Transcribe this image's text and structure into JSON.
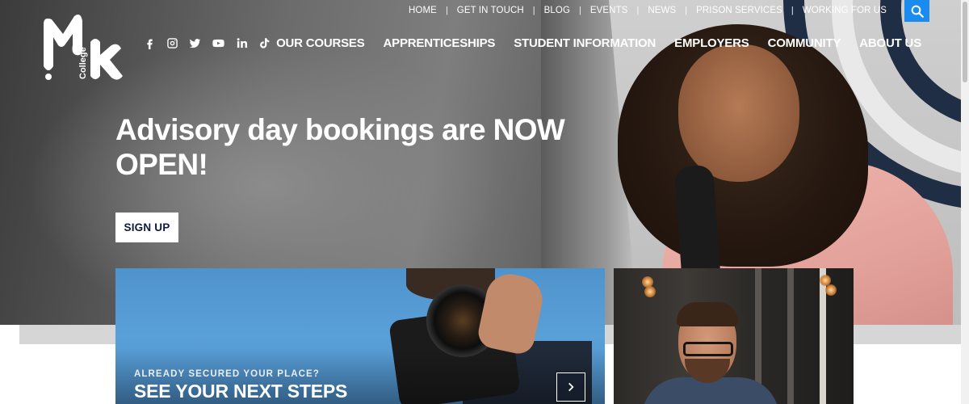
{
  "brand": {
    "logo_letters": "Mk",
    "logo_word": "College"
  },
  "social": [
    {
      "name": "facebook-icon"
    },
    {
      "name": "instagram-icon"
    },
    {
      "name": "twitter-icon"
    },
    {
      "name": "youtube-icon"
    },
    {
      "name": "linkedin-icon"
    },
    {
      "name": "tiktok-icon"
    }
  ],
  "top_nav": {
    "items": [
      "HOME",
      "GET IN TOUCH",
      "BLOG",
      "EVENTS",
      "NEWS",
      "PRISON SERVICES",
      "WORKING FOR US"
    ],
    "separator": "|",
    "search_icon": "search-icon"
  },
  "main_nav": {
    "items": [
      "OUR COURSES",
      "APPRENTICESHIPS",
      "STUDENT INFORMATION",
      "EMPLOYERS",
      "COMMUNITY",
      "ABOUT US"
    ]
  },
  "hero": {
    "title": "Advisory day bookings are NOW OPEN!",
    "cta": "SIGN UP"
  },
  "cards": [
    {
      "kicker": "ALREADY SECURED YOUR PLACE?",
      "title": "SEE YOUR NEXT STEPS",
      "arrow_icon": "chevron-right-icon"
    }
  ],
  "colors": {
    "accent_blue": "#1a8cf0",
    "navy_text": "#0f1a3a",
    "white": "#ffffff"
  }
}
